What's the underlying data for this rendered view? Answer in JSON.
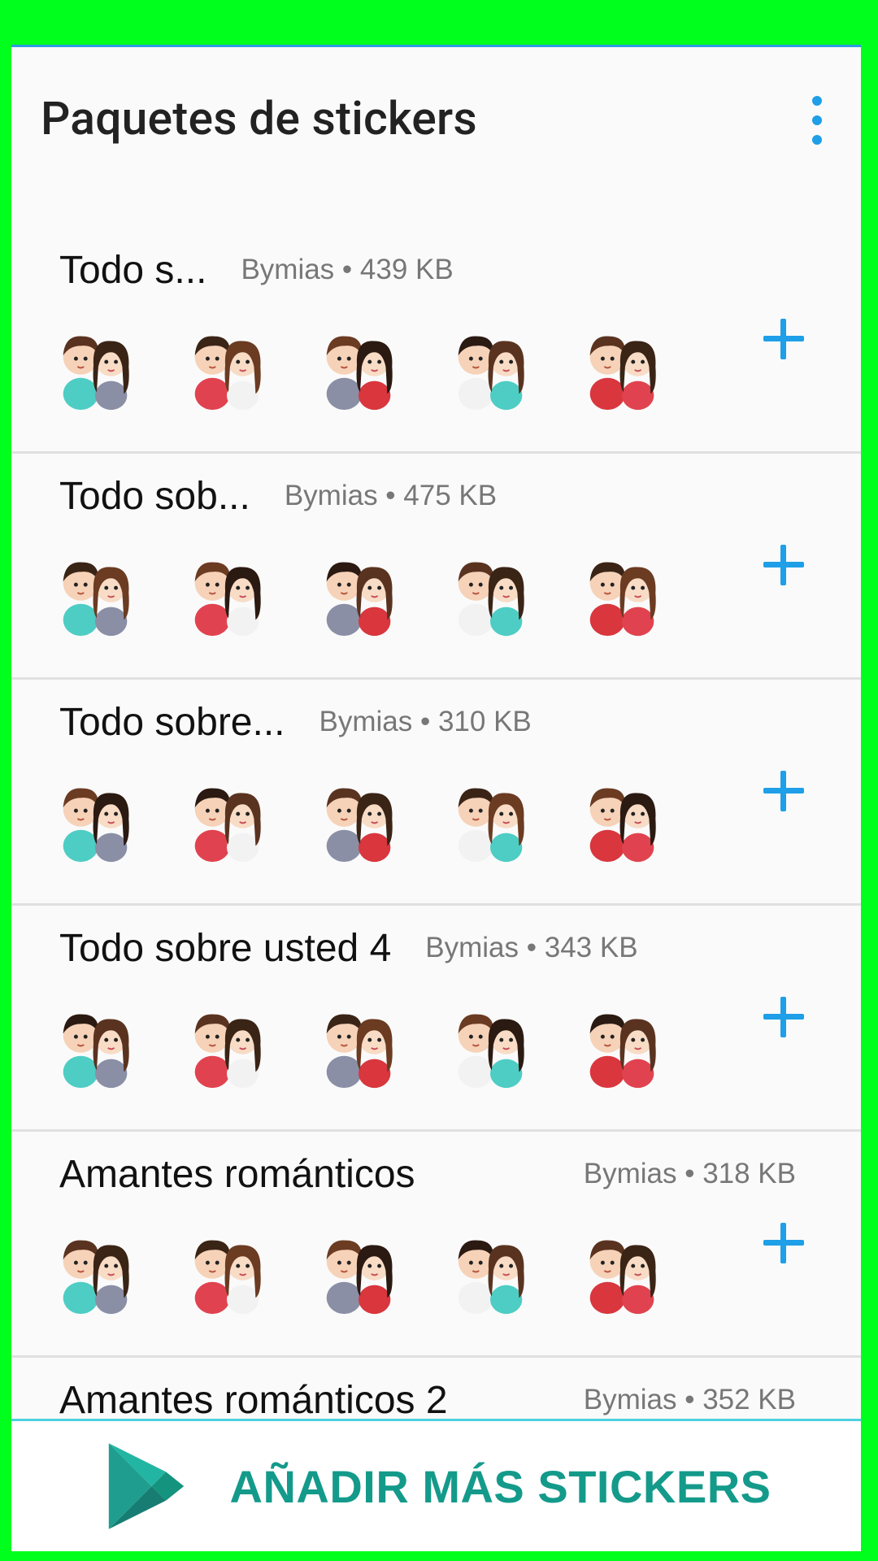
{
  "app": {
    "title": "Paquetes de stickers",
    "menu_icon": "more-vert-icon",
    "accent_color": "#1E9FE8"
  },
  "packs": [
    {
      "name": "Todo s...",
      "publisher": "Bymias",
      "size": "439 KB",
      "add_icon": "plus-icon"
    },
    {
      "name": "Todo sob...",
      "publisher": "Bymias",
      "size": "475 KB",
      "add_icon": "plus-icon"
    },
    {
      "name": "Todo sobre...",
      "publisher": "Bymias",
      "size": "310 KB",
      "add_icon": "plus-icon"
    },
    {
      "name": "Todo sobre usted 4",
      "publisher": "Bymias",
      "size": "343 KB",
      "add_icon": "plus-icon"
    },
    {
      "name": "Amantes románticos",
      "publisher": "Bymias",
      "size": "318 KB",
      "add_icon": "plus-icon"
    },
    {
      "name": "Amantes románticos 2",
      "publisher": "Bymias",
      "size": "352 KB",
      "add_icon": "plus-icon"
    }
  ],
  "bottom_bar": {
    "label": "AÑADIR MÁS STICKERS",
    "icon": "play-store-icon",
    "label_color": "#149A8A"
  },
  "meta_separator": " • "
}
